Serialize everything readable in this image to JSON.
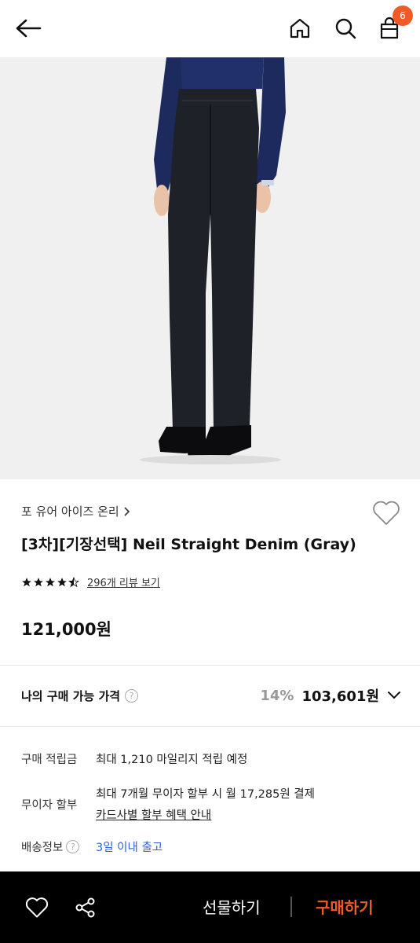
{
  "header": {
    "back_icon": "arrow-left-icon",
    "home_icon": "home-icon",
    "search_icon": "search-icon",
    "bag_icon": "shopping-bag-icon",
    "cart_count": "6"
  },
  "product": {
    "brand": "포 유어 아이즈 온리",
    "title": "[3차][기장선택] Neil Straight Denim (Gray)",
    "rating_stars": 4.5,
    "review_link": "296개 리뷰 보기",
    "price": "121,000원"
  },
  "my_price": {
    "label": "나의 구매 가능 가격",
    "discount": "14%",
    "final_price": "103,601원"
  },
  "info": {
    "points_label": "구매 적립금",
    "points_value": "최대 1,210 마일리지 적립 예정",
    "installment_label": "무이자 할부",
    "installment_value": "최대 7개월 무이자 할부 시 월 17,285원 결제",
    "installment_link": "카드사별 할부 혜택 안내",
    "shipping_label": "배송정보",
    "shipping_value": "3일 이내 출고"
  },
  "bottom_bar": {
    "gift_label": "선물하기",
    "buy_label": "구매하기"
  },
  "colors": {
    "accent": "#f05a28",
    "link_blue": "#2d62d6",
    "bar_bg": "#000000"
  }
}
